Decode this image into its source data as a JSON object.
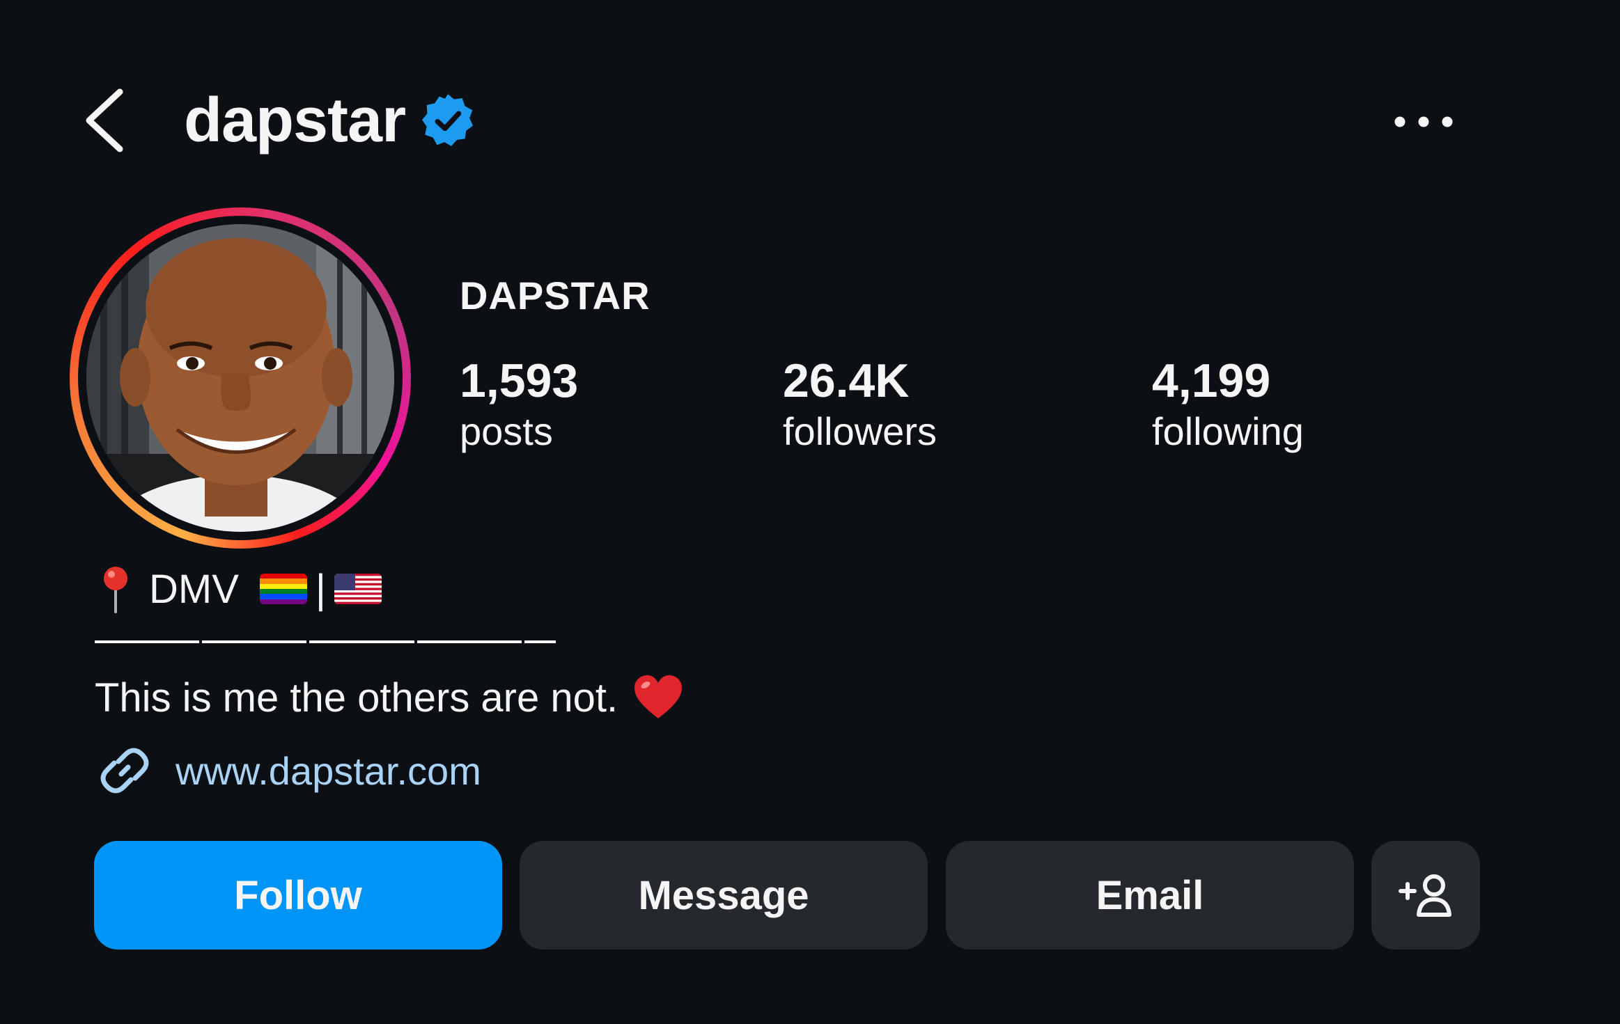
{
  "header": {
    "username": "dapstar",
    "verified_color": "#1d9bf0",
    "back_icon": "chevron-left-icon",
    "more_icon": "more-horizontal-icon"
  },
  "profile": {
    "display_name": "DAPSTAR",
    "stats": [
      {
        "value": "1,593",
        "label": "posts"
      },
      {
        "value": "26.4K",
        "label": "followers"
      },
      {
        "value": "4,199",
        "label": "following"
      }
    ]
  },
  "bio": {
    "location": "DMV",
    "flag_separator": "|",
    "quote": "This is me the others are not.",
    "link": "www.dapstar.com",
    "link_color": "#a9d2f5"
  },
  "actions": {
    "follow_label": "Follow",
    "message_label": "Message",
    "email_label": "Email",
    "follow_color": "#0095f6",
    "secondary_color": "#25292e"
  },
  "theme": {
    "background": "#0c1014",
    "text": "#f5f5f5"
  }
}
